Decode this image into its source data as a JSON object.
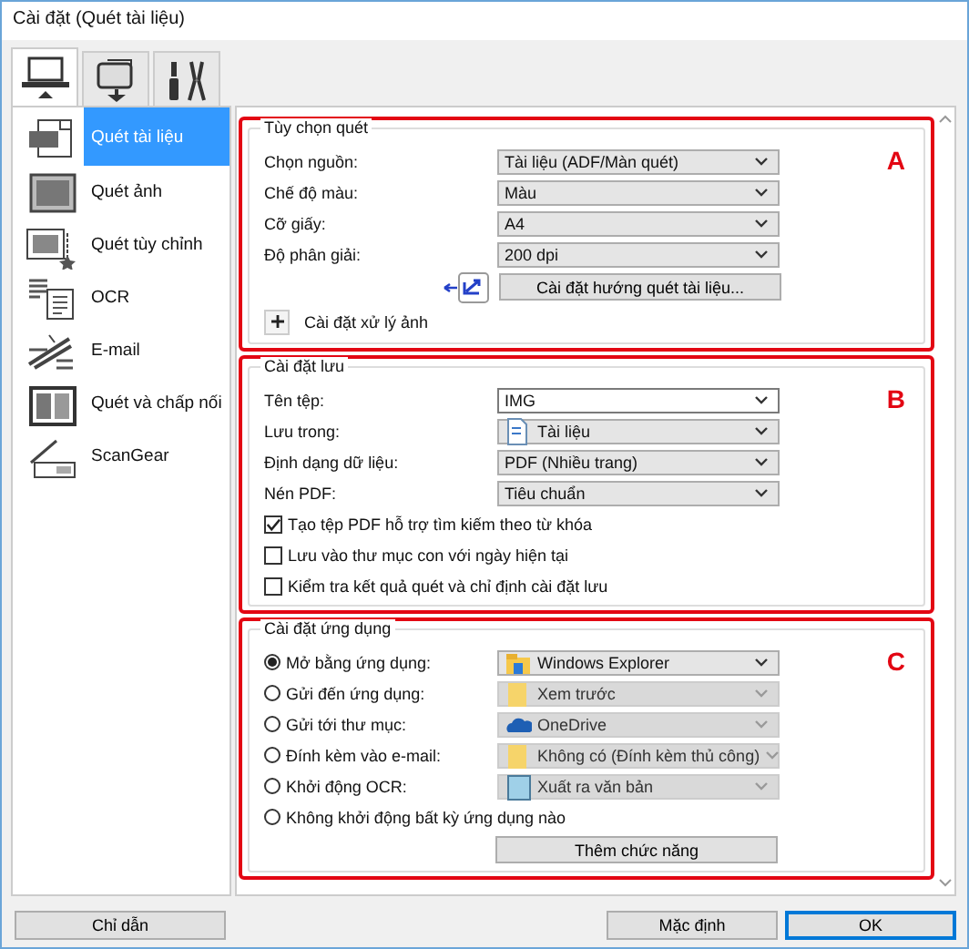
{
  "window": {
    "title": "Cài đặt (Quét tài liệu)"
  },
  "tabs": [
    {
      "selected": true
    },
    {
      "selected": false
    },
    {
      "selected": false
    }
  ],
  "sidebar": {
    "items": [
      {
        "label": "Quét tài liệu",
        "selected": true
      },
      {
        "label": "Quét ảnh",
        "selected": false
      },
      {
        "label": "Quét tùy chỉnh",
        "selected": false
      },
      {
        "label": "OCR",
        "selected": false
      },
      {
        "label": "E-mail",
        "selected": false
      },
      {
        "label": "Quét và chấp nối",
        "selected": false
      },
      {
        "label": "ScanGear",
        "selected": false
      }
    ]
  },
  "sections": [
    {
      "title": "Tùy chọn quét",
      "marker": "A",
      "rows": [
        {
          "kind": "select",
          "label": "Chọn nguồn:",
          "value": "Tài liệu (ADF/Màn quét)",
          "disabled": false
        },
        {
          "kind": "select",
          "label": "Chế độ màu:",
          "value": "Màu",
          "disabled": false
        },
        {
          "kind": "select",
          "label": "Cỡ giấy:",
          "value": "A4",
          "disabled": false
        },
        {
          "kind": "select",
          "label": "Độ phân giải:",
          "value": "200 dpi",
          "disabled": false
        },
        {
          "kind": "button",
          "label": "Cài đặt hướng quét tài liệu..."
        },
        {
          "kind": "expander",
          "label": "Cài đặt xử lý ảnh",
          "expanded": false
        }
      ]
    },
    {
      "title": "Cài đặt lưu",
      "marker": "B",
      "rows": [
        {
          "kind": "combo",
          "label": "Tên tệp:",
          "value": "IMG"
        },
        {
          "kind": "select",
          "label": "Lưu trong:",
          "value": "Tài liệu",
          "disabled": false
        },
        {
          "kind": "select",
          "label": "Định dạng dữ liệu:",
          "value": "PDF (Nhiều trang)",
          "disabled": false
        },
        {
          "kind": "select",
          "label": "Nén PDF:",
          "value": "Tiêu chuẩn",
          "disabled": false
        },
        {
          "kind": "checkbox",
          "label": "Tạo tệp PDF hỗ trợ tìm kiếm theo từ khóa",
          "checked": true
        },
        {
          "kind": "checkbox",
          "label": "Lưu vào thư mục con với ngày hiện tại",
          "checked": false
        },
        {
          "kind": "checkbox",
          "label": "Kiểm tra kết quả quét và chỉ định cài đặt lưu",
          "checked": false
        }
      ]
    },
    {
      "title": "Cài đặt ứng dụng",
      "marker": "C",
      "rows": [
        {
          "kind": "radio-select",
          "label": "Mở bằng ứng dụng:",
          "value": "Windows Explorer",
          "selected": true,
          "disabled": false
        },
        {
          "kind": "radio-select",
          "label": "Gửi đến ứng dụng:",
          "value": "Xem trước",
          "selected": false,
          "disabled": true
        },
        {
          "kind": "radio-select",
          "label": "Gửi tới thư mục:",
          "value": "OneDrive",
          "selected": false,
          "disabled": true
        },
        {
          "kind": "radio-select",
          "label": "Đính kèm vào e-mail:",
          "value": "Không có (Đính kèm thủ công)",
          "selected": false,
          "disabled": true
        },
        {
          "kind": "radio-select",
          "label": "Khởi động OCR:",
          "value": "Xuất ra văn bản",
          "selected": false,
          "disabled": true
        },
        {
          "kind": "radio",
          "label": "Không khởi động bất kỳ ứng dụng nào",
          "selected": false
        },
        {
          "kind": "button",
          "label": "Thêm chức năng"
        }
      ]
    }
  ],
  "buttons": {
    "left": [
      "Chỉ dẫn"
    ],
    "right": [
      "Mặc định",
      "OK"
    ]
  }
}
